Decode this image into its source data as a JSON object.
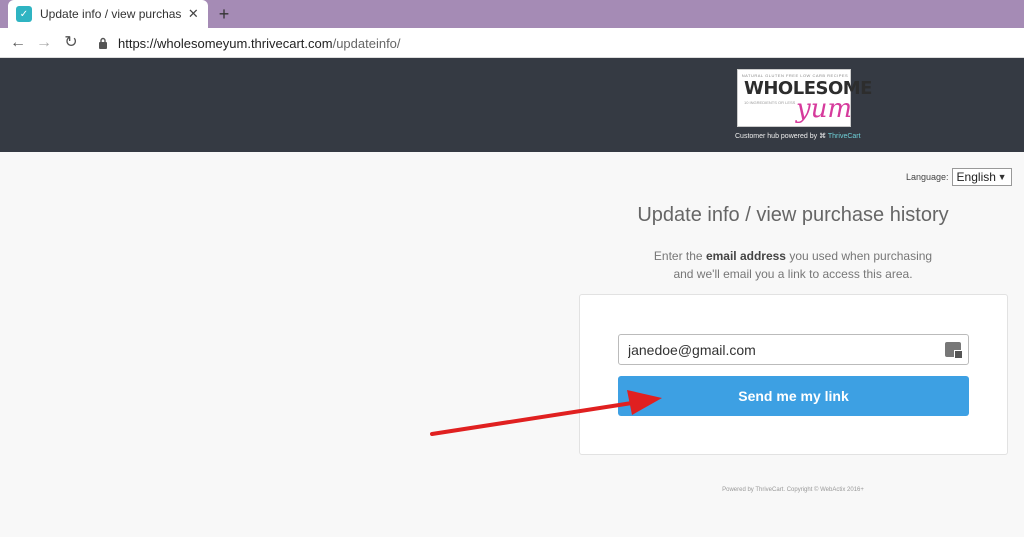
{
  "browser": {
    "tab_title": "Update info / view purchase history",
    "tab_close": "✕",
    "new_tab": "+",
    "url_host": "https://wholesomeyum.thrivecart.com",
    "url_path": "/updateinfo/"
  },
  "header": {
    "logo_small_top": "NATURAL GLUTEN FREE LOW CARB RECIPES",
    "logo_word": "WHOLESOME",
    "logo_script": "yum",
    "logo_tagline": "10 INGREDIENTS OR LESS",
    "hub_text": "Customer hub powered by",
    "hub_brand": "ThriveCart"
  },
  "language": {
    "label": "Language:",
    "selected": "English"
  },
  "main": {
    "heading": "Update info / view purchase history",
    "sub_prefix": "Enter the ",
    "sub_bold": "email address",
    "sub_suffix": " you used when purchasing",
    "sub_line2": "and we'll email you a link to access this area."
  },
  "form": {
    "email_value": "janedoe@gmail.com",
    "button_label": "Send me my link"
  },
  "footer": {
    "text": "Powered by ThriveCart. Copyright © WebActix 2016+"
  },
  "colors": {
    "tabbar": "#a58bb5",
    "header": "#353a43",
    "button": "#3da0e3",
    "arrow": "#e02020",
    "logo_accent": "#d63a9c"
  }
}
